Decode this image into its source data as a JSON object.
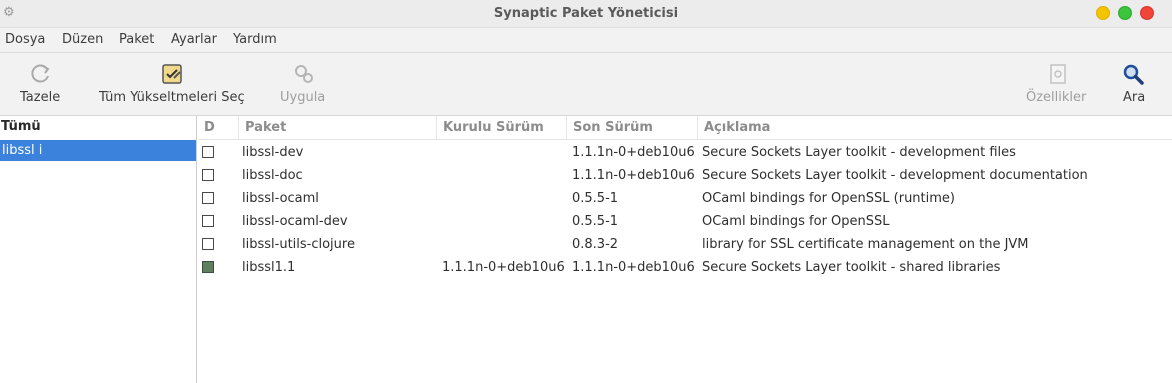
{
  "window": {
    "title": "Synaptic Paket Yöneticisi",
    "accent": "#3a82dc"
  },
  "menubar": {
    "items": [
      "Dosya",
      "Düzen",
      "Paket",
      "Ayarlar",
      "Yardım"
    ]
  },
  "toolbar": {
    "reload_label": "Tazele",
    "mark_upgrades_label": "Tüm Yükseltmeleri Seç",
    "apply_label": "Uygula",
    "properties_label": "Özellikler",
    "search_label": "Ara"
  },
  "sidebar": {
    "header": "Tümü",
    "selected_item": "libssl i"
  },
  "table": {
    "headers": [
      "D",
      "Paket",
      "Kurulu Sürüm",
      "Son Sürüm",
      "Açıklama"
    ],
    "rows": [
      {
        "status": "not-installed",
        "name": "libssl-dev",
        "installed": "",
        "latest": "1.1.1n-0+deb10u6",
        "description": "Secure Sockets Layer toolkit - development files"
      },
      {
        "status": "not-installed",
        "name": "libssl-doc",
        "installed": "",
        "latest": "1.1.1n-0+deb10u6",
        "description": "Secure Sockets Layer toolkit - development documentation"
      },
      {
        "status": "not-installed",
        "name": "libssl-ocaml",
        "installed": "",
        "latest": "0.5.5-1",
        "description": "OCaml bindings for OpenSSL (runtime)"
      },
      {
        "status": "not-installed",
        "name": "libssl-ocaml-dev",
        "installed": "",
        "latest": "0.5.5-1",
        "description": "OCaml bindings for OpenSSL"
      },
      {
        "status": "not-installed",
        "name": "libssl-utils-clojure",
        "installed": "",
        "latest": "0.8.3-2",
        "description": "library for SSL certificate management on the JVM"
      },
      {
        "status": "installed",
        "name": "libssl1.1",
        "installed": "1.1.1n-0+deb10u6",
        "latest": "1.1.1n-0+deb10u6",
        "description": "Secure Sockets Layer toolkit - shared libraries"
      }
    ]
  }
}
